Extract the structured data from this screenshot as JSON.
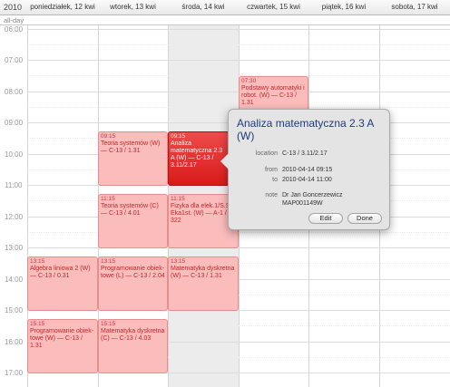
{
  "header": {
    "year": "2010",
    "days": [
      "poniedziałek, 12 kwi",
      "wtorek, 13 kwi",
      "środa, 14 kwi",
      "czwartek, 15 kwi",
      "piątek, 16 kwi",
      "sobota, 17 kwi"
    ]
  },
  "allday_label": "all-day",
  "hours": [
    "06:00",
    "07:00",
    "08:00",
    "09:00",
    "10:00",
    "11:00",
    "12:00",
    "13:00",
    "14:00",
    "15:00",
    "16:00",
    "17:00"
  ],
  "events": [
    {
      "time": "07:30",
      "title": "Podstawy automatyki i robot. (W) — C-13 / 1.31"
    },
    {
      "time": "09:15",
      "title": "Teoria systemów (W) — C-13 / 1.31"
    },
    {
      "time": "09:15",
      "title": "Analiza matematyczna 2.3 A (W) — C-13 / 3.11/2.17"
    },
    {
      "time": "11:15",
      "title": "Teoria systemów (C) — C-13 / 4.01"
    },
    {
      "time": "11:15",
      "title": "Fizyka dla elek.1/S.ST. Eka1st. (W) — A-1 / 322"
    },
    {
      "time": "13:15",
      "title": "Algebra liniowa 2 (W) — C-13 / 0.31"
    },
    {
      "time": "13:15",
      "title": "Programowanie obiek-towe (L) — C-13 / 2.04"
    },
    {
      "time": "13:15",
      "title": "Matematyka dyskretna (W) — C-13 / 1.31"
    },
    {
      "time": "15:15",
      "title": "Programowanie obiek-towe (W) — C-13 / 1.31"
    },
    {
      "time": "15:15",
      "title": "Matematyka dyskretna (C) — C-13 / 4.03"
    }
  ],
  "popover": {
    "title": "Analiza matematyczna 2.3 A (W)",
    "location_label": "location",
    "location": "C-13 / 3.11/2.17",
    "from_label": "from",
    "from": "2010-04-14 09:15",
    "to_label": "to",
    "to": "2010-04-14 11:00",
    "note_label": "note",
    "note_line1": "Dr Jan Goncerzewicz",
    "note_line2": "MAP001149W",
    "edit_label": "Edit",
    "done_label": "Done"
  },
  "colors": {
    "event_fill": "#fbbcbc",
    "event_border": "#e98c8c",
    "event_text": "#c32828",
    "selected_event": "#e22a2a",
    "popover_title": "#1d3a7a",
    "today_column": "#ececec"
  }
}
